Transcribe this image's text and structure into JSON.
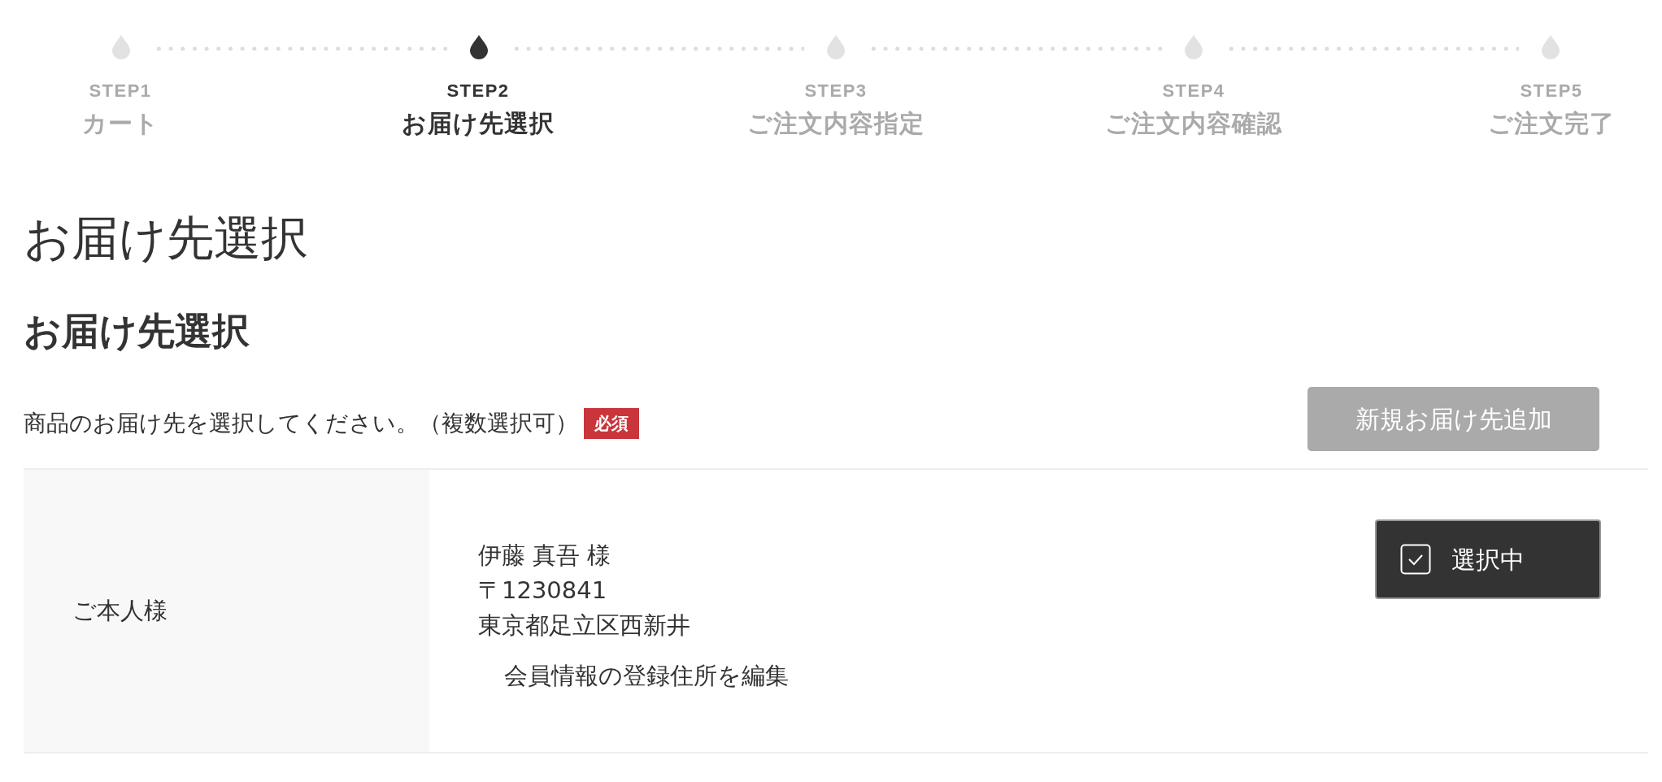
{
  "steps": [
    {
      "number": "STEP1",
      "label": "カート",
      "selected": false
    },
    {
      "number": "STEP2",
      "label": "お届け先選択",
      "selected": true
    },
    {
      "number": "STEP3",
      "label": "ご注文内容指定",
      "selected": false
    },
    {
      "number": "STEP4",
      "label": "ご注文内容確認",
      "selected": false
    },
    {
      "number": "STEP5",
      "label": "ご注文完了",
      "selected": false
    }
  ],
  "page_title": "お届け先選択",
  "section": {
    "title": "お届け先選択",
    "instruction": "商品のお届け先を選択してください。（複数選択可）",
    "required_badge": "必須",
    "add_button": "新規お届け先追加"
  },
  "addresses": [
    {
      "recipient_type": "ご本人様",
      "name": "伊藤 真吾 様",
      "postal_code": "〒1230841",
      "address": "東京都足立区西新井",
      "edit_link": "会員情報の登録住所を編集",
      "select_button": "選択中",
      "selected": true
    }
  ]
}
